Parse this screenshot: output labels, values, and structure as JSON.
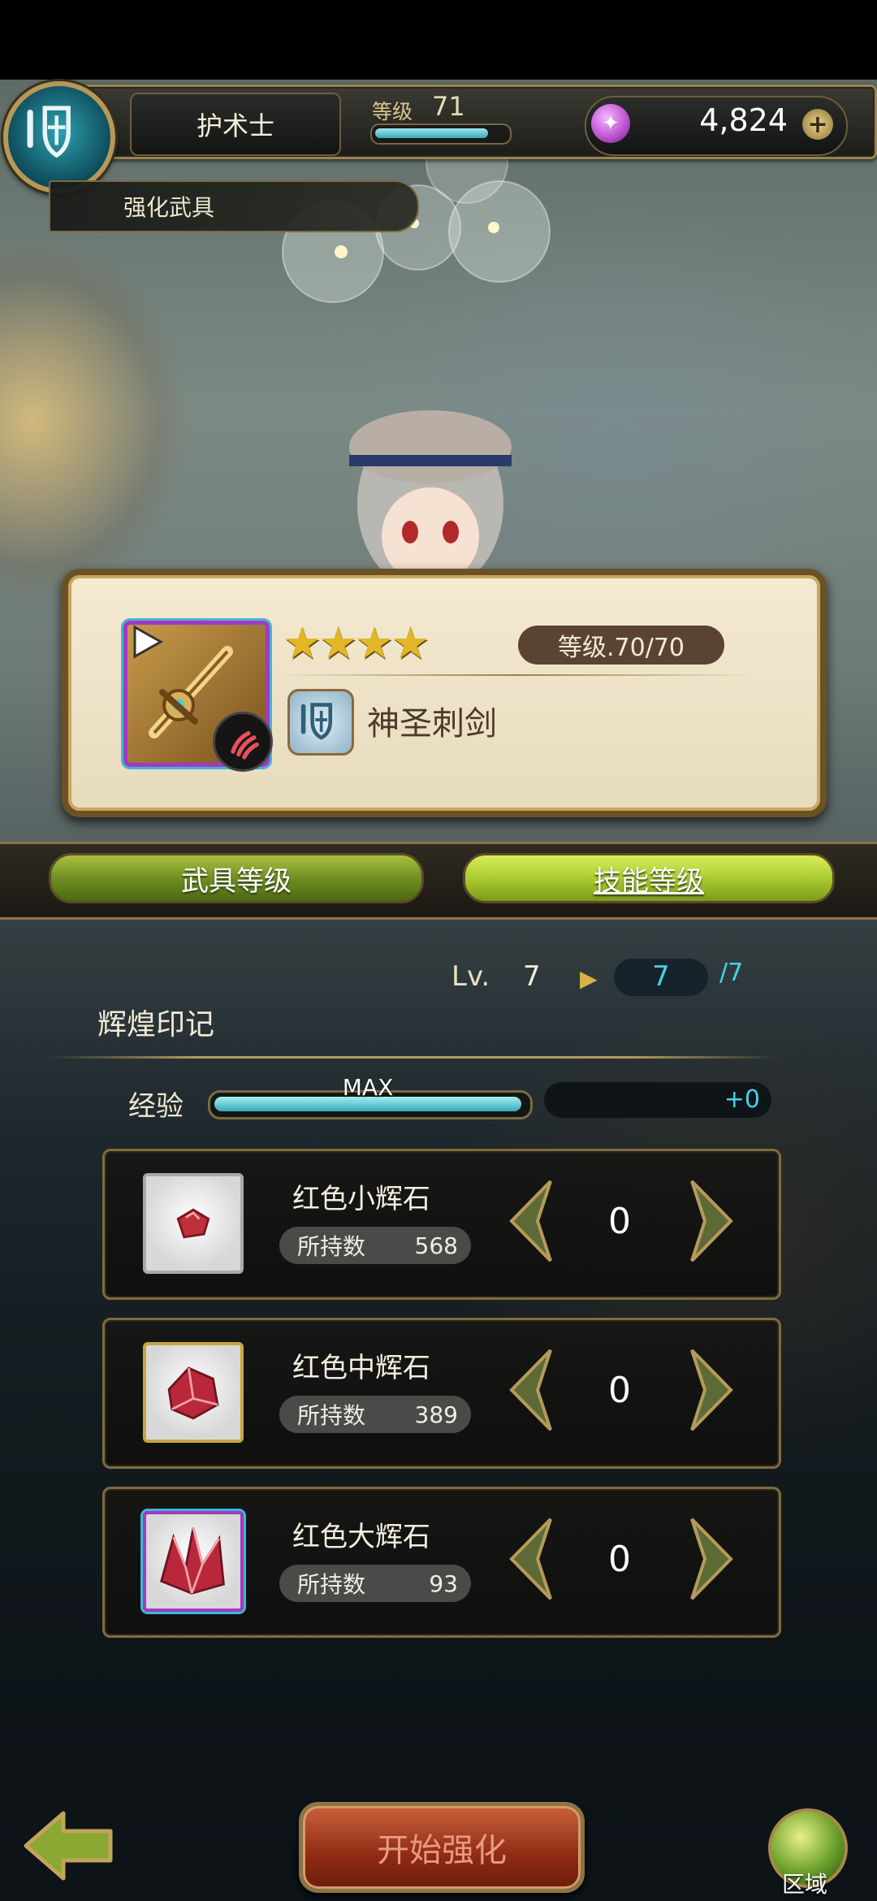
{
  "header": {
    "class_name": "护术士",
    "level_label": "等级",
    "level_value": "71",
    "level_progress": 0.88,
    "currency_amount": "4,824",
    "currency_icon": "gem-icon",
    "add_icon": "plus-icon"
  },
  "breadcrumb": "强化武具",
  "weapon": {
    "stars": "★★★★",
    "star_count": 4,
    "level_text": "等级.70/70",
    "name": "神圣刺剑",
    "element_icon": "fire-claw-icon",
    "class_icon": "shield-sword-icon",
    "accent": "#a13bc2"
  },
  "tabs": [
    {
      "label": "武具等级",
      "active": false
    },
    {
      "label": "技能等级",
      "active": true
    }
  ],
  "skill": {
    "lv_label": "Lv.",
    "lv_current": "7",
    "lv_next": "7",
    "lv_max": "/7",
    "name": "辉煌印记",
    "exp_label": "经验",
    "exp_status": "MAX",
    "exp_progress": 1.0,
    "exp_gain": "+0"
  },
  "stones": [
    {
      "name": "红色小辉石",
      "owned_label": "所持数",
      "owned": "568",
      "qty": "0",
      "frame": "#a9a9a9"
    },
    {
      "name": "红色中辉石",
      "owned_label": "所持数",
      "owned": "389",
      "qty": "0",
      "frame": "#c9a640"
    },
    {
      "name": "红色大辉石",
      "owned_label": "所持数",
      "owned": "93",
      "qty": "0",
      "frame": "#a13bc2"
    }
  ],
  "footer": {
    "start_label": "开始强化",
    "area_label": "区域"
  },
  "colors": {
    "gold": "#9a8450",
    "cyan": "#48d2e6",
    "green_tab": "#a6c82c",
    "start_red": "#8f2a14"
  }
}
